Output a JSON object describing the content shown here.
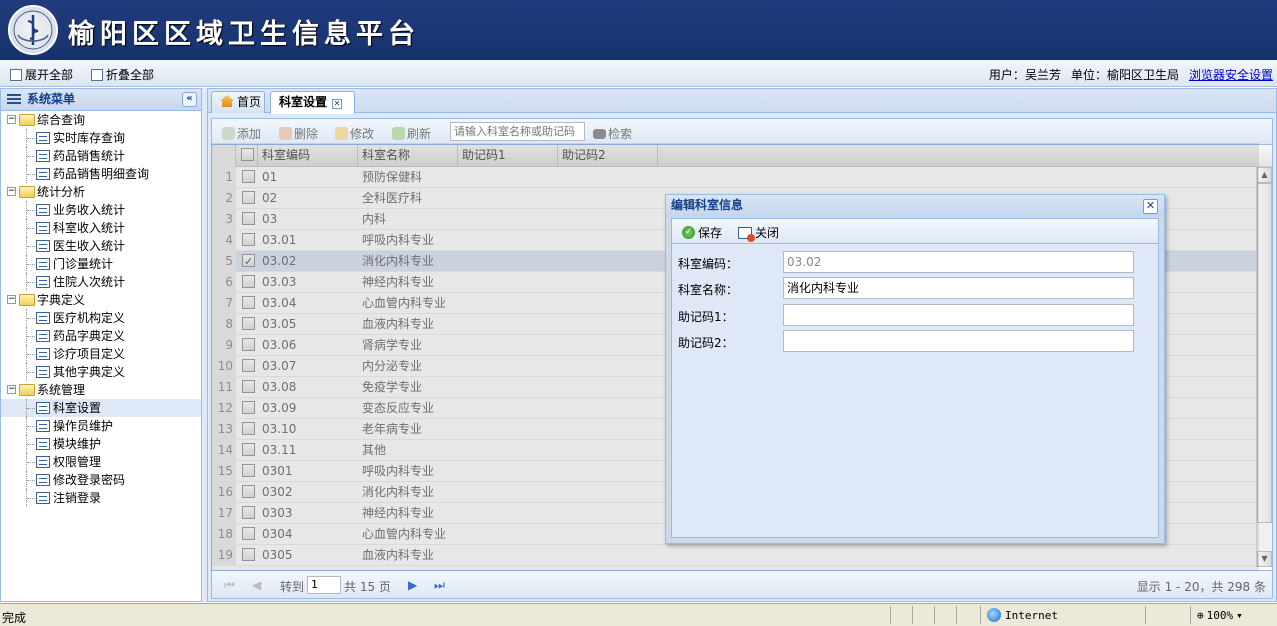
{
  "app": {
    "title": "榆阳区区域卫生信息平台"
  },
  "topbar": {
    "expand_all": "展开全部",
    "collapse_all": "折叠全部",
    "user_label": "用户：",
    "user_name": "吴兰芳",
    "unit_label": "单位：",
    "unit_name": "榆阳区卫生局",
    "browser_settings": "浏览器安全设置"
  },
  "sidebar": {
    "title": "系统菜单",
    "collapse_glyph": "«",
    "groups": [
      {
        "label": "综合查询",
        "items": [
          "实时库存查询",
          "药品销售统计",
          "药品销售明细查询"
        ]
      },
      {
        "label": "统计分析",
        "items": [
          "业务收入统计",
          "科室收入统计",
          "医生收入统计",
          "门诊量统计",
          "住院人次统计"
        ]
      },
      {
        "label": "字典定义",
        "items": [
          "医疗机构定义",
          "药品字典定义",
          "诊疗项目定义",
          "其他字典定义"
        ]
      },
      {
        "label": "系统管理",
        "items": [
          "科室设置",
          "操作员维护",
          "模块维护",
          "权限管理",
          "修改登录密码",
          "注销登录"
        ]
      }
    ],
    "selected": "科室设置"
  },
  "tabs": [
    {
      "label": "首页",
      "active": false
    },
    {
      "label": "科室设置",
      "active": true
    }
  ],
  "grid": {
    "toolbar": {
      "add": "添加",
      "delete": "删除",
      "edit": "修改",
      "refresh": "刷新",
      "search_placeholder": "请输入科室名称或助记码",
      "search": "检索"
    },
    "columns": [
      "科室编码",
      "科室名称",
      "助记码1",
      "助记码2"
    ],
    "rows": [
      {
        "n": "1",
        "code": "01",
        "name": "预防保健科"
      },
      {
        "n": "2",
        "code": "02",
        "name": "全科医疗科"
      },
      {
        "n": "3",
        "code": "03",
        "name": "内科"
      },
      {
        "n": "4",
        "code": "03.01",
        "name": "呼吸内科专业"
      },
      {
        "n": "5",
        "code": "03.02",
        "name": "消化内科专业",
        "selected": true
      },
      {
        "n": "6",
        "code": "03.03",
        "name": "神经内科专业"
      },
      {
        "n": "7",
        "code": "03.04",
        "name": "心血管内科专业"
      },
      {
        "n": "8",
        "code": "03.05",
        "name": "血液内科专业"
      },
      {
        "n": "9",
        "code": "03.06",
        "name": "肾病学专业"
      },
      {
        "n": "10",
        "code": "03.07",
        "name": "内分泌专业"
      },
      {
        "n": "11",
        "code": "03.08",
        "name": "免疫学专业"
      },
      {
        "n": "12",
        "code": "03.09",
        "name": "变态反应专业"
      },
      {
        "n": "13",
        "code": "03.10",
        "name": "老年病专业"
      },
      {
        "n": "14",
        "code": "03.11",
        "name": "其他"
      },
      {
        "n": "15",
        "code": "0301",
        "name": "呼吸内科专业"
      },
      {
        "n": "16",
        "code": "0302",
        "name": "消化内科专业"
      },
      {
        "n": "17",
        "code": "0303",
        "name": "神经内科专业"
      },
      {
        "n": "18",
        "code": "0304",
        "name": "心血管内科专业"
      },
      {
        "n": "19",
        "code": "0305",
        "name": "血液内科专业"
      }
    ],
    "pager": {
      "goto": "转到",
      "page": "1",
      "total_pages": "共 15 页",
      "display": "显示 1 - 20，共 298 条"
    }
  },
  "dialog": {
    "title": "编辑科室信息",
    "save": "保存",
    "close": "关闭",
    "fields": [
      {
        "label": "科室编码：",
        "value": "03.02"
      },
      {
        "label": "科室名称：",
        "value": "消化内科专业"
      },
      {
        "label": "助记码1：",
        "value": ""
      },
      {
        "label": "助记码2：",
        "value": ""
      }
    ]
  },
  "statusbar": {
    "status": "完成",
    "zone": "Internet",
    "zoom": "100%"
  }
}
